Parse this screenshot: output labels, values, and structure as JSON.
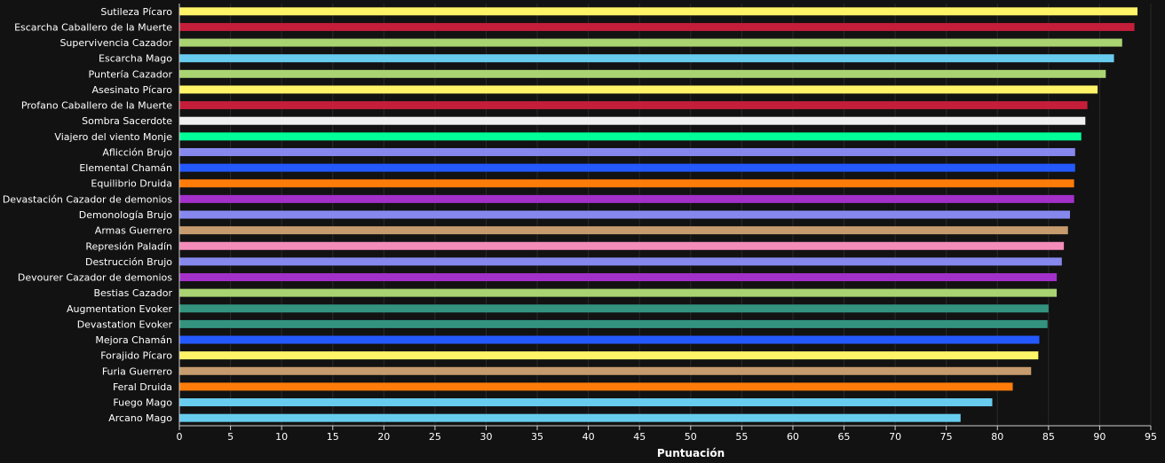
{
  "chart_data": {
    "type": "bar",
    "orientation": "horizontal",
    "title": "",
    "xlabel": "Puntuación",
    "ylabel": "",
    "xlim": [
      0,
      95
    ],
    "x_ticks": [
      0,
      5,
      10,
      15,
      20,
      25,
      30,
      35,
      40,
      45,
      50,
      55,
      60,
      65,
      70,
      75,
      80,
      85,
      90,
      95
    ],
    "grid": true,
    "legend": "none",
    "categories": [
      "Sutileza Pícaro",
      "Escarcha Caballero de la Muerte",
      "Supervivencia Cazador",
      "Escarcha Mago",
      "Puntería Cazador",
      "Asesinato Pícaro",
      "Profano Caballero de la Muerte",
      "Sombra Sacerdote",
      "Viajero del viento Monje",
      "Aflicción Brujo",
      "Elemental Chamán",
      "Equilibrio Druida",
      "Devastación Cazador de demonios",
      "Demonología Brujo",
      "Armas Guerrero",
      "Represión Paladín",
      "Destrucción Brujo",
      "Devourer Cazador de demonios",
      "Bestias Cazador",
      "Augmentation Evoker",
      "Devastation Evoker",
      "Mejora Chamán",
      "Forajido Pícaro",
      "Furia Guerrero",
      "Feral Druida",
      "Fuego Mago",
      "Arcano Mago"
    ],
    "values": [
      93.7,
      93.4,
      92.2,
      91.4,
      90.6,
      89.8,
      88.8,
      88.6,
      88.2,
      87.6,
      87.6,
      87.5,
      87.5,
      87.1,
      86.9,
      86.5,
      86.3,
      85.8,
      85.8,
      85.0,
      84.9,
      84.1,
      84.0,
      83.3,
      81.5,
      79.5,
      76.4
    ],
    "colors": [
      "#FFF468",
      "#C41E3A",
      "#AAD372",
      "#68CCEF",
      "#AAD372",
      "#FFF468",
      "#C41E3A",
      "#F0F0F0",
      "#00FF98",
      "#8788EE",
      "#2459FF",
      "#FF7C0A",
      "#A330C9",
      "#8788EE",
      "#C69B6D",
      "#F48CBA",
      "#8788EE",
      "#A330C9",
      "#AAD372",
      "#33937F",
      "#33937F",
      "#2459FF",
      "#FFF468",
      "#C69B6D",
      "#FF7C0A",
      "#68CCEF",
      "#68CCEF"
    ]
  }
}
